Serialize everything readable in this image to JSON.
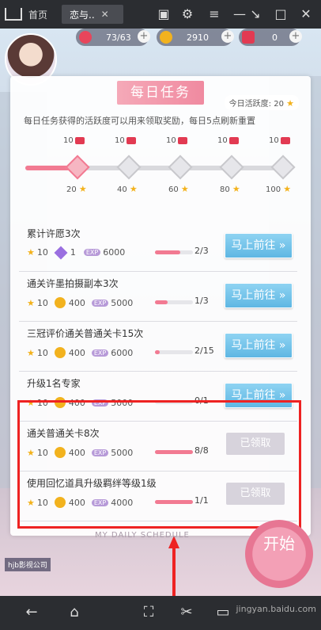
{
  "browser": {
    "tabs": [
      {
        "label": "首页"
      },
      {
        "label": "恋与.."
      }
    ],
    "close_glyph": "✕"
  },
  "resources": {
    "hearts": "73/63",
    "coins": "2910",
    "gems": "0"
  },
  "header": {
    "title": "每日任务",
    "activity_label": "今日活跃度: 20",
    "description": "每日任务获得的活跃度可以用来领取奖励，每日5点刷新重置"
  },
  "milestones": {
    "rewards": [
      "10",
      "10",
      "10",
      "10",
      "10"
    ],
    "thresholds": [
      "20",
      "40",
      "60",
      "80",
      "100"
    ],
    "progress": 0.2
  },
  "tasks": [
    {
      "name": "累计许愿3次",
      "stars": "10",
      "extra": "1",
      "coins": "",
      "exp": "6000",
      "progress_text": "2/3",
      "progress": 0.67,
      "button": "马上前往",
      "claimed": false
    },
    {
      "name": "通关许墨拍摄副本3次",
      "stars": "10",
      "extra": "",
      "coins": "400",
      "exp": "5000",
      "progress_text": "1/3",
      "progress": 0.33,
      "button": "马上前往",
      "claimed": false
    },
    {
      "name": "三冠评价通关普通关卡15次",
      "stars": "10",
      "extra": "",
      "coins": "400",
      "exp": "6000",
      "progress_text": "2/15",
      "progress": 0.13,
      "button": "马上前往",
      "claimed": false
    },
    {
      "name": "升级1名专家",
      "stars": "10",
      "extra": "",
      "coins": "400",
      "exp": "5000",
      "progress_text": "0/1",
      "progress": 0,
      "button": "马上前往",
      "claimed": false
    },
    {
      "name": "通关普通关卡8次",
      "stars": "10",
      "extra": "",
      "coins": "400",
      "exp": "5000",
      "progress_text": "8/8",
      "progress": 1,
      "button": "已领取",
      "claimed": true
    },
    {
      "name": "使用回忆道具升级羁绊等级1级",
      "stars": "10",
      "extra": "",
      "coins": "400",
      "exp": "4000",
      "progress_text": "1/1",
      "progress": 1,
      "button": "已领取",
      "claimed": true
    }
  ],
  "footer": {
    "schedule_label": "MY DAILY SCHEDULE",
    "start_label": "开始",
    "studio_label": "hjb影视公司"
  },
  "watermark": "jingyan.baidu.com"
}
